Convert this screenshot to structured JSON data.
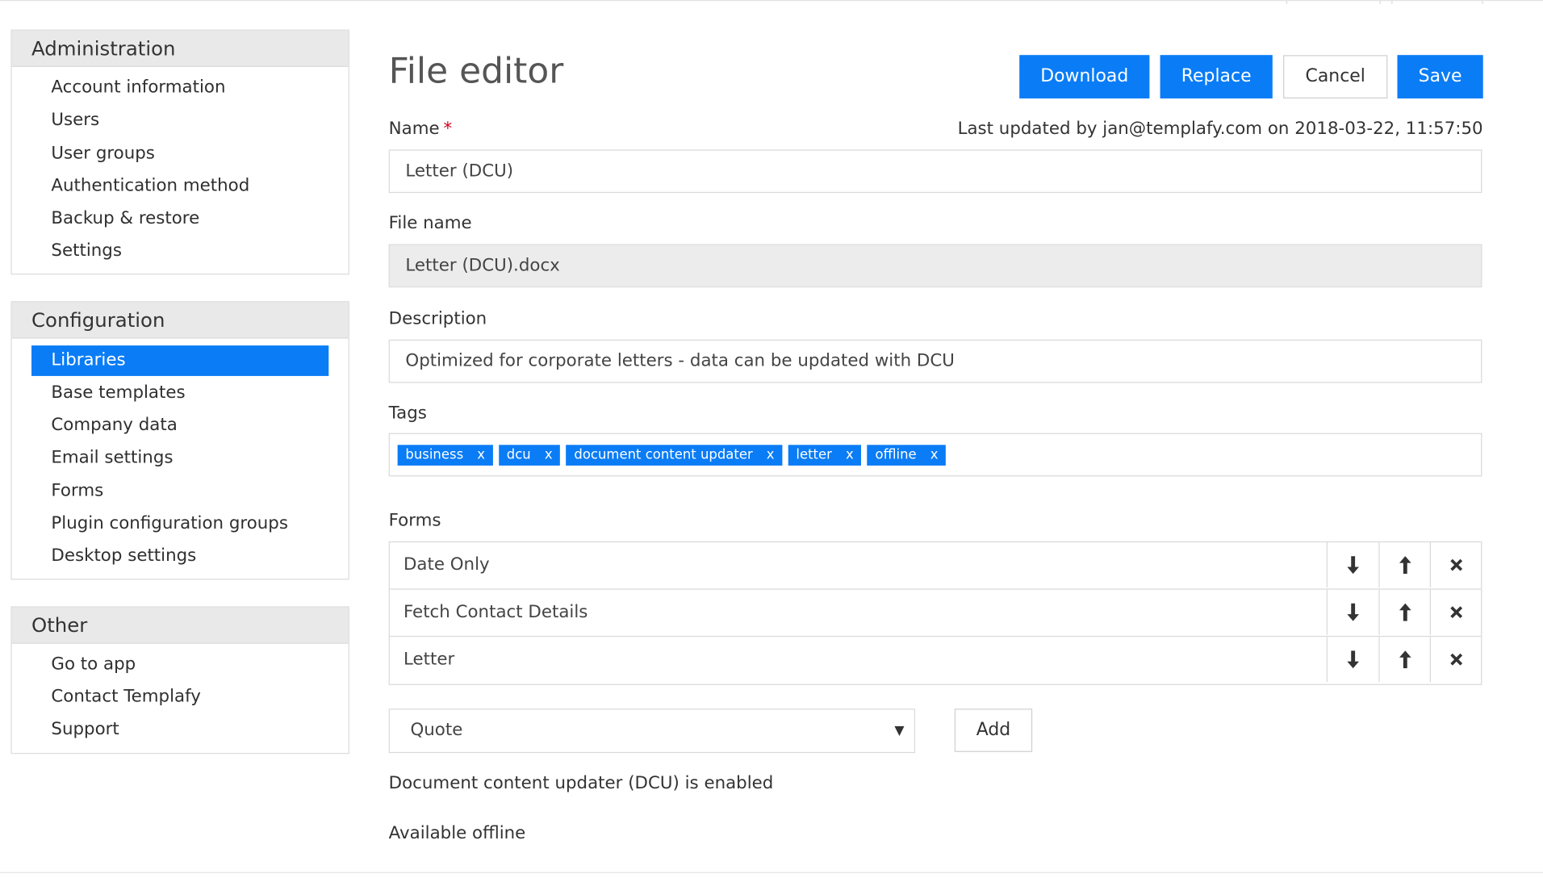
{
  "sidebar": {
    "administration": {
      "title": "Administration",
      "items": [
        "Account information",
        "Users",
        "User groups",
        "Authentication method",
        "Backup & restore",
        "Settings"
      ]
    },
    "configuration": {
      "title": "Configuration",
      "items": [
        "Libraries",
        "Base templates",
        "Company data",
        "Email settings",
        "Forms",
        "Plugin configuration groups",
        "Desktop settings"
      ],
      "active": "Libraries"
    },
    "other": {
      "title": "Other",
      "items": [
        "Go to app",
        "Contact Templafy",
        "Support"
      ]
    }
  },
  "header": {
    "title": "File editor",
    "buttons": {
      "download": "Download",
      "replace": "Replace",
      "cancel": "Cancel",
      "save": "Save"
    },
    "last_updated": "Last updated by jan@templafy.com on 2018-03-22, 11:57:50"
  },
  "fields": {
    "name": {
      "label": "Name",
      "required_mark": "*",
      "value": "Letter (DCU)"
    },
    "file_name": {
      "label": "File name",
      "value": "Letter (DCU).docx"
    },
    "description": {
      "label": "Description",
      "value": "Optimized for corporate letters - data can be updated with DCU"
    },
    "tags": {
      "label": "Tags",
      "remove_glyph": "x",
      "items": [
        "business",
        "dcu",
        "document content updater",
        "letter",
        "offline"
      ]
    }
  },
  "forms": {
    "label": "Forms",
    "rows": [
      "Date Only",
      "Fetch Contact Details",
      "Letter"
    ],
    "icons": [
      "arrow-down-icon",
      "arrow-up-icon",
      "close-icon"
    ],
    "select_value": "Quote",
    "add_label": "Add"
  },
  "status": {
    "dcu": "Document content updater (DCU) is enabled",
    "offline": "Available offline"
  },
  "colors": {
    "accent": "#0a7cf6",
    "panel_header_bg": "#e9e9e9",
    "readonly_bg": "#ececec"
  }
}
